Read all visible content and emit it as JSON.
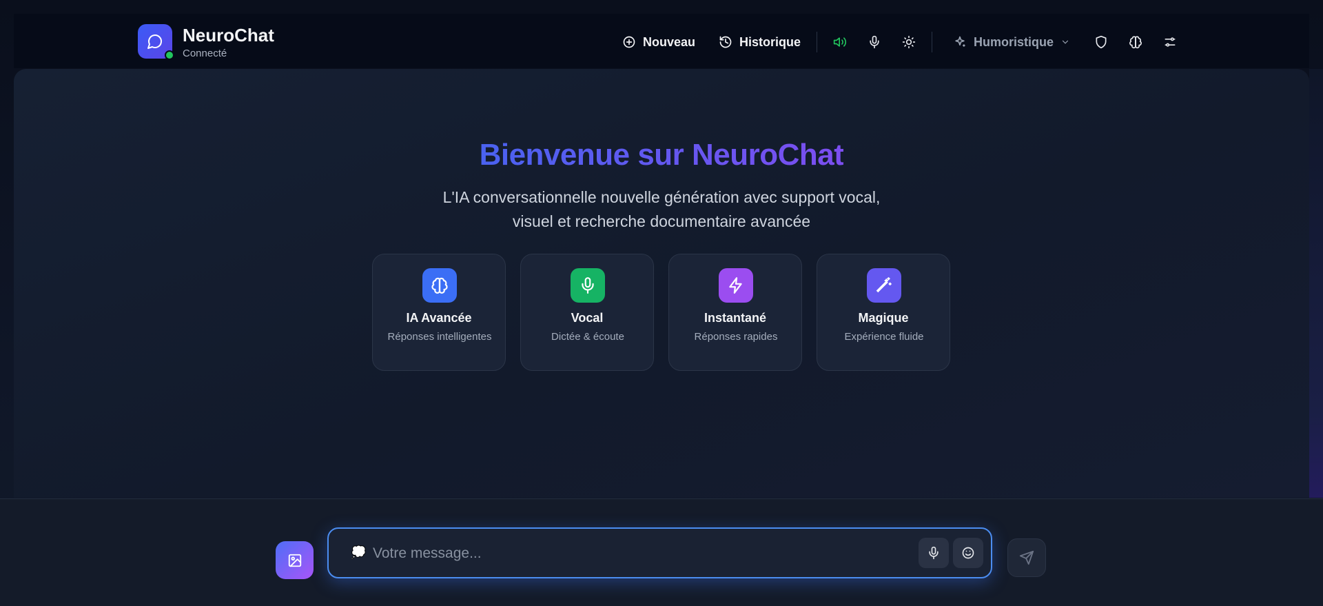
{
  "app": {
    "name": "NeuroChat",
    "status": "Connecté"
  },
  "header": {
    "new_label": "Nouveau",
    "history_label": "Historique",
    "mode_label": "Humoristique"
  },
  "icons": [
    "chat-bubble-icon",
    "plus-circle-icon",
    "history-icon",
    "speaker-icon",
    "mic-icon",
    "sun-icon",
    "sparkle-icon",
    "chevron-down-icon",
    "shield-icon",
    "brain-icon",
    "sliders-icon",
    "zap-icon",
    "wand-icon",
    "image-icon",
    "smile-icon",
    "send-icon"
  ],
  "colors": {
    "accent": "#4a62f0",
    "online": "#22c55e",
    "speaker_active": "#22c55e",
    "input_border": "#4b8df0"
  },
  "welcome": {
    "title": "Bienvenue sur NeuroChat",
    "subtitle_line1": "L'IA conversationnelle nouvelle génération avec support vocal,",
    "subtitle_line2": "visuel et recherche documentaire avancée"
  },
  "features": [
    {
      "title": "IA Avancée",
      "desc": "Réponses intelligentes",
      "color": "#3b6ef5"
    },
    {
      "title": "Vocal",
      "desc": "Dictée & écoute",
      "color": "#16b364"
    },
    {
      "title": "Instantané",
      "desc": "Réponses rapides",
      "color": "#9b4df0"
    },
    {
      "title": "Magique",
      "desc": "Expérience fluide",
      "color": "#6458f0"
    }
  ],
  "composer": {
    "placeholder": "Votre message...",
    "prefix_emoji": "💭"
  }
}
